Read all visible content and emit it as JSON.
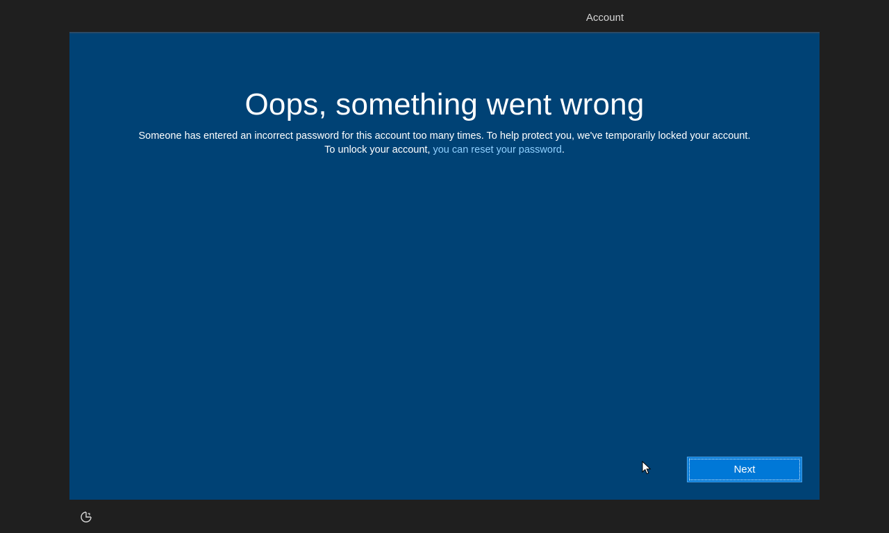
{
  "header": {
    "tab_label": "Account"
  },
  "main": {
    "title": "Oops, something went wrong",
    "message_line1": "Someone has entered an incorrect password for this account too many times. To help protect you, we've temporarily locked your account.",
    "message_line2_prefix": "To unlock your account, ",
    "reset_link": "you can reset your password",
    "message_line2_suffix": "."
  },
  "footer": {
    "next_label": "Next",
    "ease_of_access_icon": "ease-of-access-icon"
  },
  "colors": {
    "panel_background": "#004275",
    "page_background": "#1f1f1f",
    "accent": "#0078d7",
    "link": "#8fd0ff"
  }
}
